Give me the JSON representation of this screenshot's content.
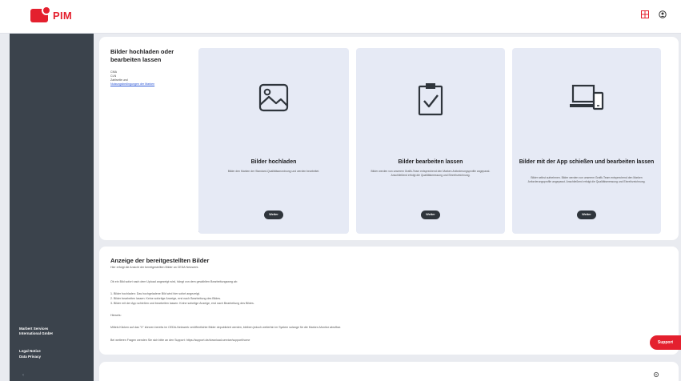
{
  "header": {
    "app_name": "PIM",
    "flag_icon": "flag-icon",
    "user_icon": "user-icon"
  },
  "sidebar": {
    "company_line1": "Marbert Services",
    "company_line2": "International GmbH",
    "legal_notice": "Legal Notice",
    "data_privacy": "Data Privacy"
  },
  "intro": {
    "title": "Bilder hochladen oder bearbeiten lassen",
    "list": [
      "CMA",
      "CLN",
      "Zahlseite und"
    ],
    "link": "Nutzungsbedingungen der Marken"
  },
  "cards": [
    {
      "title": "Bilder hochladen",
      "desc": "Bilder den Marken der Standard-Qualitätsanordnung und werden bearbeitet.",
      "button": "Weiter"
    },
    {
      "title": "Bilder bearbeiten lassen",
      "desc": "Bilder werden von unserem Grafik-Team entsprechend den Marken Anforderungsprofile angepasst. Anschließend erfolgt die Qualitätsmessung und Einreihzeichnung.",
      "button": "Weiter"
    },
    {
      "title": "Bilder mit der App schießen und bearbeiten lassen",
      "desc": "Bilder selbst aufnehmen. Bilder werden von unserem Grafik-Team entsprechend den Marken Anforderungsprofile angepasst. Anschließend erfolgt die Qualitätsmessung und Einreihzeichnung.",
      "button": "Weiter"
    }
  ],
  "section2": {
    "title": "Anzeige der bereitgestellten Bilder",
    "subtitle": "Hier erfolgt die Ansicht der bereitgestellten Bilder an CEDA Netzwerk.",
    "lines": [
      "Ob ein Bild sofort nach dem Upload angezeigt wird, hängt von dem gewählten Bearbeitungsweg ab:",
      "1. Bilder hochladen: Das hochgeladene Bild wird hier sofort angezeigt.",
      "2. Bilder bearbeiten lassen: Keine sofortige Anzeige, erst nach Bearbeitung des Bildes.",
      "3. Bilder mit der App schießen und bearbeiten lassen: Keine sofortige Anzeige, erst nach Bearbeitung des Bildes.",
      "Hinweis:",
      "Mittels Klicken auf das \"X\" können bereits im CEDA-Netzwerk veröffentlichte Bilder depubliziert werden, bleiben jedoch weiterhin im System solange für die Marken-Monitor abrufbar.",
      "Bei weiteren Fragen wenden Sie sich bitte an den Support: https://support.de/download-service/support/home"
    ]
  },
  "support": {
    "label": "Support"
  },
  "colors": {
    "brand_red": "#e4202e",
    "sidebar": "#3b434c",
    "card_bg": "#e6eaf5"
  }
}
